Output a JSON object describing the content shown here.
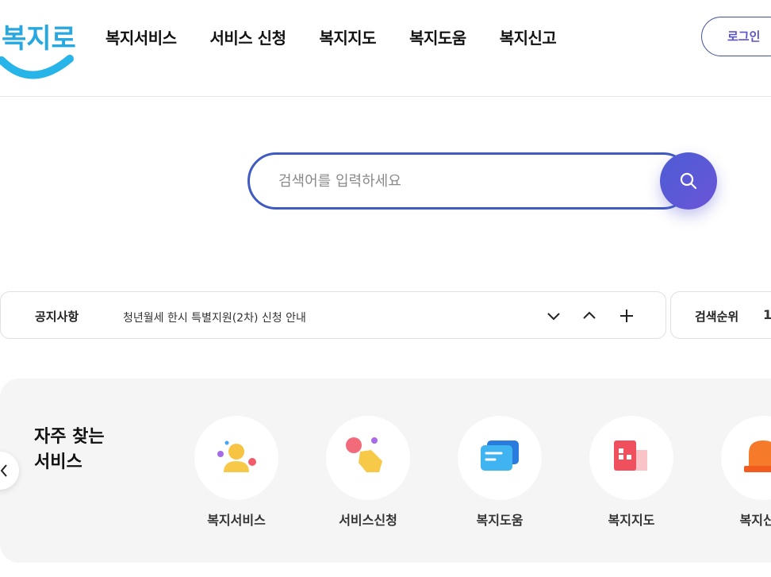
{
  "header": {
    "logo_text": "복지로",
    "nav": [
      "복지서비스",
      "서비스 신청",
      "복지지도",
      "복지도움",
      "복지신고"
    ],
    "login_label": "로그인"
  },
  "search": {
    "placeholder": "검색어를 입력하세요",
    "button_icon": "search-icon"
  },
  "notice": {
    "label": "공지사항",
    "text": "청년월세 한시 특별지원(2차) 신청 안내",
    "controls": [
      "chevron-down-icon",
      "chevron-up-icon",
      "plus-icon"
    ]
  },
  "ranking": {
    "label": "검색순위",
    "first_rank": "1"
  },
  "frequent": {
    "title_line1": "자주 찾는",
    "title_line2": "서비스",
    "items": [
      {
        "label": "복지서비스",
        "icon": "person-icon"
      },
      {
        "label": "서비스신청",
        "icon": "tap-hand-icon"
      },
      {
        "label": "복지도움",
        "icon": "chat-bubble-icon"
      },
      {
        "label": "복지지도",
        "icon": "building-icon"
      },
      {
        "label": "복지신고",
        "icon": "siren-icon"
      }
    ]
  },
  "colors": {
    "accent": "#3f5bc2",
    "accent_purple": "#6a55d8",
    "logo_blue": "#27a8e0",
    "background_section": "#f5f5f5"
  }
}
